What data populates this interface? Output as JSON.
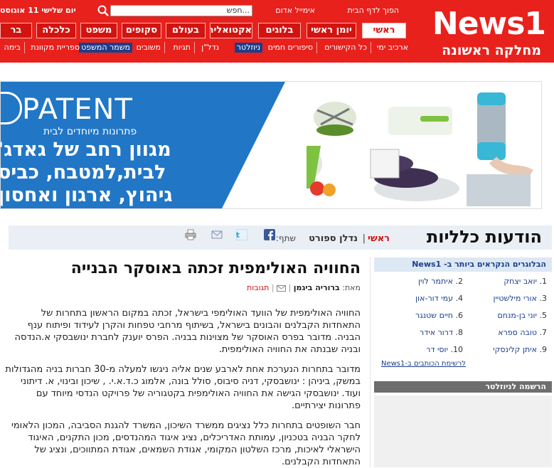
{
  "header": {
    "logo": "News1",
    "logo_sub": "מחלקה ראשונה",
    "top_links": [
      "הפוך לדף הבית",
      "אימייל אדום"
    ],
    "search_placeholder": "...חפש",
    "date": "יום שלישי 11 אוגוסט",
    "nav_tabs": [
      "ראשי",
      "יומן ראשי",
      "בלוגים",
      "אקטואליה",
      "בעולם",
      "סקופים",
      "משפט",
      "כלכלה",
      "בר"
    ],
    "sub_links": [
      "ארכיב ימי",
      "כל הקישורים",
      "סיפורים חמים",
      "ניוזלטר",
      "נדל\"ן",
      "תגיות",
      "משובים",
      "משמר המשפט",
      "ספריית מקוונת",
      "בימה"
    ]
  },
  "banner": {
    "brand": "PATENT",
    "tagline": "פתרונות מיוחדים לבית",
    "lines": [
      "מגוון רחב של גאדג'",
      "לבית,למטבח, כביס",
      "גיהוץ, ארגון ואחסון"
    ]
  },
  "content": {
    "section_title": "הודעות כלליות",
    "crumb_home": "ראשי",
    "crumb_sep": "|",
    "crumb_sport": "נדלן ספורט",
    "share_label": "שתף:",
    "article_title": "החוויה האולימפית זכתה באוסקר הבנייה",
    "byline_prefix": "מאת:",
    "byline_author": "ברוריה ביגמן",
    "byline_tags": "תגובות",
    "paragraphs": [
      "החוויה האולימפית של הוועד האולימפי בישראל, זכתה במקום הראשון בתחרות של התאחדות הקבלנים והבונים בישראל, בשיתוף מרחבי טפחות והקרן לעידוד ופיתוח ענף הבניה. מדובר בפרס האוסקר של מצוינות בבניה. הפרס יוענק לחברת ינושבסקי א.הנדסה ובניה שבנתה את החוויה האולימפית.",
      "מדובר בתחרות הנערכת אחת לארבע שנים אליה ניגשו למעלה מ-30 חברות בניה מהגדולות במשק, ביניהן : ינושבסקי, דניה סיבוס, סולל בונה, אלמוג כ.ד.א.י. , שיכון ובינוי, א. דיתוני ועוד. ינושבסקי הגישה את החוויה האולימפית בקטגוריה של פרויקט הנדסי מיוחד עם פתרונות יצירתיים.",
      "חבר השופטים בתחרות כלל נציגים ממשרד השיכון, המשרד להגנת הסביבה, המכון הלאומי לחקר הבניה בטכניון, עמותת האדריכלים, נציג איגוד המהנדסים, מכון התקנים, האיגוד הישראלי לאיכות, מרכז השלטון המקומי, אגודת השמאים, אגודת המתווכים, ונציג של התאחדות הקבלנים."
    ]
  },
  "sidebar": {
    "title": "הבלוגרים הנקראים ביותר ב- News1",
    "bloggers": [
      {
        "num": "1.",
        "name": "יואב יצחק"
      },
      {
        "num": "2.",
        "name": "איתמר לוין"
      },
      {
        "num": "3.",
        "name": "אורי מילשטיין"
      },
      {
        "num": "4.",
        "name": "עמי דור-און"
      },
      {
        "num": "5.",
        "name": "יוני בן-מנחם"
      },
      {
        "num": "6.",
        "name": "חיים שטנגר"
      },
      {
        "num": "7.",
        "name": "טובה ספרא"
      },
      {
        "num": "8.",
        "name": "דרור אידר"
      },
      {
        "num": "9.",
        "name": "איתן קלינסקי"
      },
      {
        "num": "10.",
        "name": "יוסי דר"
      }
    ],
    "writers_link": "לרשימת הכותבים ב-News1",
    "newsletter": "הרשמה לניוזלטר"
  },
  "colors": {
    "brand_red": "#e8211c",
    "nav_blue": "#1c3d8c",
    "banner_blue": "#2176c6"
  }
}
